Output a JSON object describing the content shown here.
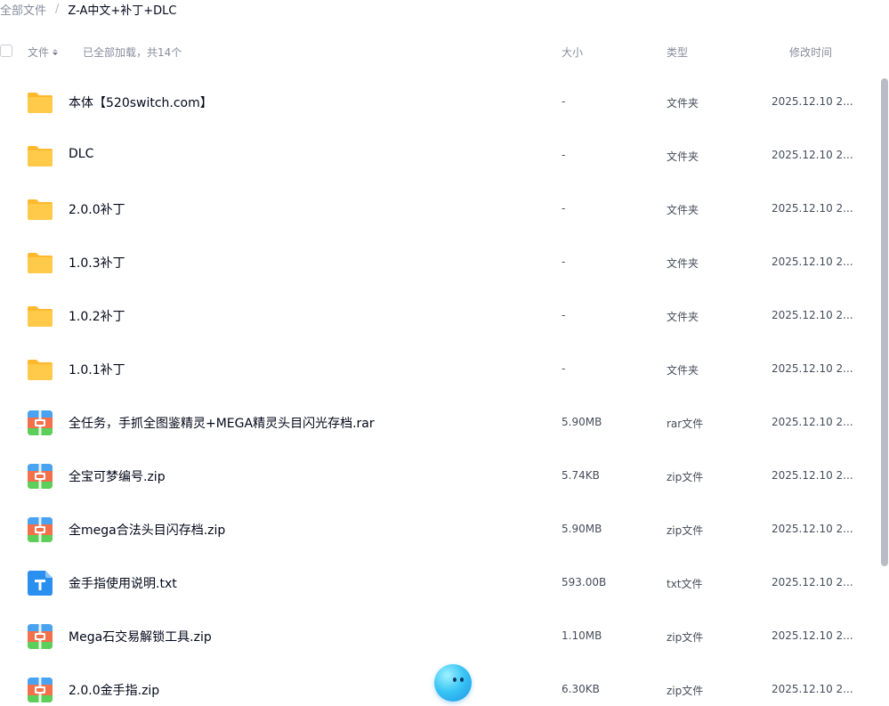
{
  "breadcrumb": {
    "root": "全部文件",
    "separator": "/",
    "current": "Z-A中文+补丁+DLC"
  },
  "header": {
    "name_label": "文件",
    "load_status": "已全部加载，共14个",
    "size_label": "大小",
    "type_label": "类型",
    "mtime_label": "修改时间"
  },
  "files": [
    {
      "name": "本体【520switch.com】",
      "size": "-",
      "type": "文件夹",
      "mtime": "2025.12.10 2...",
      "icon": "folder-icon"
    },
    {
      "name": "DLC",
      "size": "-",
      "type": "文件夹",
      "mtime": "2025.12.10 2...",
      "icon": "folder-icon"
    },
    {
      "name": "2.0.0补丁",
      "size": "-",
      "type": "文件夹",
      "mtime": "2025.12.10 2...",
      "icon": "folder-icon"
    },
    {
      "name": "1.0.3补丁",
      "size": "-",
      "type": "文件夹",
      "mtime": "2025.12.10 2...",
      "icon": "folder-icon"
    },
    {
      "name": "1.0.2补丁",
      "size": "-",
      "type": "文件夹",
      "mtime": "2025.12.10 2...",
      "icon": "folder-icon"
    },
    {
      "name": "1.0.1补丁",
      "size": "-",
      "type": "文件夹",
      "mtime": "2025.12.10 2...",
      "icon": "folder-icon"
    },
    {
      "name": "全任务，手抓全图鉴精灵+MEGA精灵头目闪光存档.rar",
      "size": "5.90MB",
      "type": "rar文件",
      "mtime": "2025.12.10 2...",
      "icon": "archive-icon"
    },
    {
      "name": "全宝可梦编号.zip",
      "size": "5.74KB",
      "type": "zip文件",
      "mtime": "2025.12.10 2...",
      "icon": "archive-icon"
    },
    {
      "name": "全mega合法头目闪存档.zip",
      "size": "5.90MB",
      "type": "zip文件",
      "mtime": "2025.12.10 2...",
      "icon": "archive-icon"
    },
    {
      "name": "金手指使用说明.txt",
      "size": "593.00B",
      "type": "txt文件",
      "mtime": "2025.12.10 2...",
      "icon": "text-file-icon"
    },
    {
      "name": "Mega石交易解锁工具.zip",
      "size": "1.10MB",
      "type": "zip文件",
      "mtime": "2025.12.10 2...",
      "icon": "archive-icon"
    },
    {
      "name": "2.0.0金手指.zip",
      "size": "6.30KB",
      "type": "zip文件",
      "mtime": "2025.12.10 2...",
      "icon": "archive-icon"
    }
  ],
  "colors": {
    "folder": "#ffc94a",
    "archive_top": "#4aa3f0",
    "archive_middle": "#f2704a",
    "archive_bottom": "#5ccf5a",
    "text_file": "#2b8ff0"
  }
}
